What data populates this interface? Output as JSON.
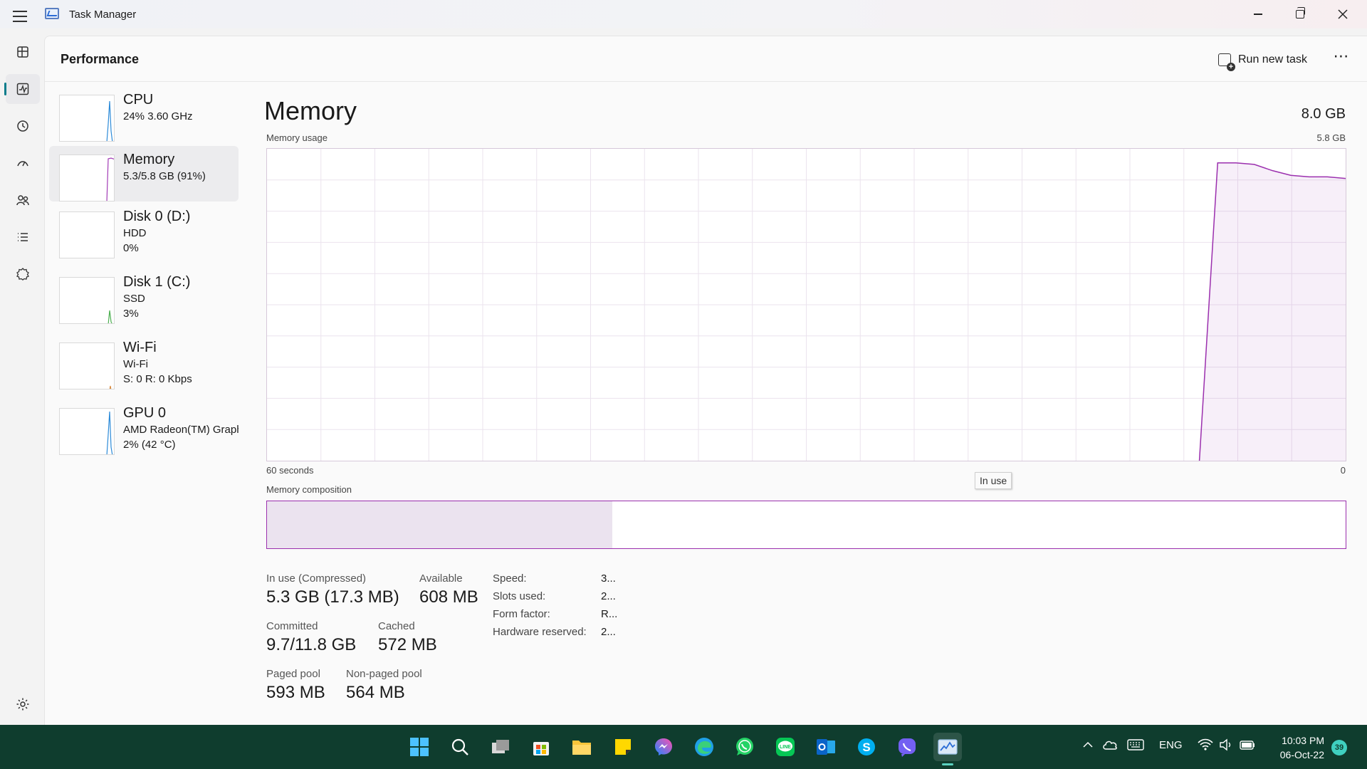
{
  "app": {
    "title": "Task Manager",
    "page": "Performance",
    "run_new_task": "Run new task",
    "more": "⋯"
  },
  "rail": {
    "items": [
      {
        "name": "processes-icon"
      },
      {
        "name": "performance-icon",
        "active": true
      },
      {
        "name": "app-history-icon"
      },
      {
        "name": "startup-apps-icon"
      },
      {
        "name": "users-icon"
      },
      {
        "name": "details-icon"
      },
      {
        "name": "services-icon"
      }
    ],
    "settings": "settings-icon"
  },
  "resources": [
    {
      "name": "CPU",
      "sub1": "24%  3.60 GHz",
      "sub2": "",
      "color": "#2d8bd8"
    },
    {
      "name": "Memory",
      "sub1": "5.3/5.8 GB (91%)",
      "sub2": "",
      "color": "#a23bb6",
      "selected": true
    },
    {
      "name": "Disk 0 (D:)",
      "sub1": "HDD",
      "sub2": "0%",
      "color": "#4caf50"
    },
    {
      "name": "Disk 1 (C:)",
      "sub1": "SSD",
      "sub2": "3%",
      "color": "#4caf50"
    },
    {
      "name": "Wi-Fi",
      "sub1": "Wi-Fi",
      "sub2": "S: 0  R: 0 Kbps",
      "color": "#d98a3c"
    },
    {
      "name": "GPU 0",
      "sub1": "AMD Radeon(TM) Graphics",
      "sub2": "2%  (42 °C)",
      "color": "#2d8bd8"
    }
  ],
  "memory": {
    "title": "Memory",
    "total": "8.0 GB",
    "usage_label": "Memory usage",
    "usage_max": "5.8 GB",
    "x_left": "60 seconds",
    "x_right": "0",
    "tooltip": "In use",
    "composition_label": "Memory composition",
    "composition_in_use_fraction": 0.32,
    "usage_history_fraction": [
      0,
      0,
      0,
      0,
      0,
      0,
      0,
      0,
      0,
      0,
      0,
      0,
      0,
      0,
      0,
      0,
      0,
      0,
      0,
      0,
      0,
      0,
      0,
      0,
      0,
      0,
      0,
      0,
      0,
      0,
      0,
      0,
      0,
      0,
      0,
      0,
      0,
      0,
      0,
      0,
      0,
      0,
      0,
      0,
      0,
      0,
      0,
      0,
      0,
      0,
      0,
      0,
      0.955,
      0.955,
      0.95,
      0.93,
      0.915,
      0.91,
      0.91,
      0.905
    ],
    "stats": {
      "in_use_label": "In use (Compressed)",
      "in_use_value": "5.3 GB (17.3 MB)",
      "available_label": "Available",
      "available_value": "608 MB",
      "committed_label": "Committed",
      "committed_value": "9.7/11.8 GB",
      "cached_label": "Cached",
      "cached_value": "572 MB",
      "paged_label": "Paged pool",
      "paged_value": "593 MB",
      "nonpaged_label": "Non-paged pool",
      "nonpaged_value": "564 MB"
    },
    "props": [
      {
        "label": "Speed:",
        "value": "3..."
      },
      {
        "label": "Slots used:",
        "value": "2..."
      },
      {
        "label": "Form factor:",
        "value": "R..."
      },
      {
        "label": "Hardware reserved:",
        "value": "2..."
      }
    ]
  },
  "taskbar": {
    "apps": [
      "start-icon",
      "search-icon",
      "task-view-icon",
      "store-icon",
      "file-explorer-icon",
      "sticky-notes-icon",
      "messenger-icon",
      "edge-icon",
      "whatsapp-icon",
      "line-icon",
      "outlook-icon",
      "skype-icon",
      "viber-icon",
      "task-manager-icon"
    ],
    "tray": {
      "chevron": "^",
      "lang": "ENG",
      "time": "10:03 PM",
      "date": "06-Oct-22",
      "notifications": "39"
    }
  },
  "colors": {
    "memory_accent": "#9b2fae",
    "taskbar_bg": "#0f3d2e"
  }
}
